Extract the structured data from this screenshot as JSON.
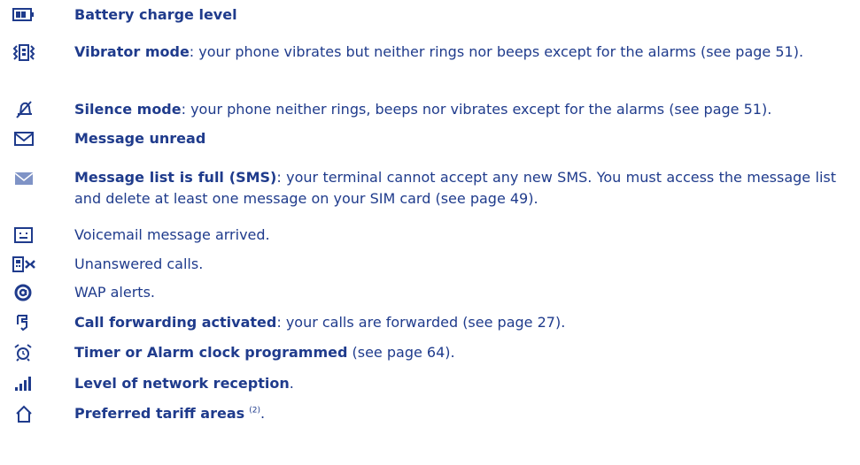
{
  "items": [
    {
      "icon": "battery-icon",
      "bold": "Battery charge level",
      "rest": ""
    },
    {
      "icon": "vibrate-icon",
      "bold": "Vibrator mode",
      "rest": ": your phone vibrates but neither rings nor beeps except for the alarms (see page 51)."
    },
    {
      "icon": "silence-icon",
      "bold": "Silence mode",
      "rest": ": your phone neither rings, beeps nor vibrates except for the alarms (see page 51)."
    },
    {
      "icon": "envelope-outline-icon",
      "bold": "Message unread",
      "rest": ""
    },
    {
      "icon": "envelope-filled-icon",
      "bold": "Message list is full (SMS)",
      "rest": ": your terminal cannot accept any new SMS. You must access the message list and delete at least one message on your SIM card (see page 49)."
    },
    {
      "icon": "voicemail-icon",
      "bold": "",
      "rest": "Voicemail message arrived."
    },
    {
      "icon": "missed-call-icon",
      "bold": "",
      "rest": "Unanswered calls."
    },
    {
      "icon": "at-sign-icon",
      "bold": "",
      "rest": "WAP alerts."
    },
    {
      "icon": "call-forward-icon",
      "bold": "Call forwarding activated",
      "rest": ": your calls are forwarded (see page 27)."
    },
    {
      "icon": "alarm-clock-icon",
      "bold": "Timer or Alarm clock programmed",
      "rest": " (see page 64)."
    },
    {
      "icon": "signal-bars-icon",
      "bold": "Level of network reception",
      "rest": "."
    },
    {
      "icon": "home-icon",
      "bold": "Preferred tariff areas",
      "rest": ".",
      "sup": "(2)"
    }
  ]
}
